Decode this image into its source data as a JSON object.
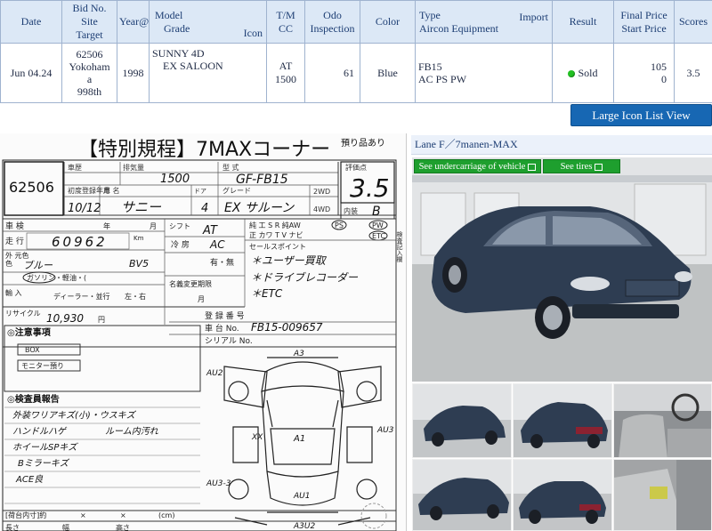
{
  "table": {
    "headers": {
      "date": "Date",
      "bid_no": "Bid No.",
      "site": "Site",
      "target": "Target",
      "year": "Year@",
      "model": "Model",
      "grade": "Grade",
      "icon": "Icon",
      "tm": "T/M",
      "cc": "CC",
      "odo": "Odo",
      "inspection": "Inspection",
      "color": "Color",
      "type": "Type",
      "import": "Import",
      "aircon_equipment": "Aircon Equipment",
      "result": "Result",
      "final_price": "Final Price",
      "start_price": "Start Price",
      "scores": "Scores"
    },
    "row": {
      "date": "Jun 04.24",
      "bid_no": "62506",
      "site_line1": "Yokoham",
      "site_line2": "a",
      "target": "998th",
      "year": "1998",
      "model_line1": "SUNNY 4D",
      "model_line2": "EX SALOON",
      "tm": "AT",
      "cc": "1500",
      "odo": "61",
      "color": "Blue",
      "type": "FB15",
      "equipment": "AC PS PW",
      "result": "Sold",
      "price_line1": "105",
      "price_line2": "0",
      "score": "3.5"
    }
  },
  "buttons": {
    "large_icon_list": "Large Icon List View",
    "undercarriage": "See undercarriage of vehicle",
    "tires": "See tires"
  },
  "lane": "Lane F／7manen-MAX",
  "sheet": {
    "title": "【特別規程】7MAXコーナー",
    "deposit": "預り品あり",
    "lot": "62506",
    "score_label": "評価点",
    "score": "3.5",
    "interior_label": "内装",
    "interior_score": "B",
    "displacement": "1500",
    "model_code": "GF-FB15",
    "year": "10/12",
    "car_name": "サニー",
    "doors": "4",
    "grade": "EX サルーン",
    "mileage": "60962",
    "color": "ブルー",
    "color_code": "BV5",
    "shift": "AT",
    "aircon": "AC",
    "price": "10,930",
    "chassis": "FB15-009657",
    "sales_points": [
      "＊ユーザー買取",
      "＊ドライブレコーダー",
      "＊ETC"
    ],
    "notes_label": "◎注意事項",
    "box_label": "BOX",
    "monitor_label": "モニター預り",
    "inspector_label": "◎検査員報告",
    "inspector_notes": [
      "外装ワリアキズ(小)・ウスキズ",
      "ハンドルハゲ",
      "ルーム内汚れ",
      "ホイールSPキズ",
      "Bミラーキズ",
      "ACE良"
    ],
    "diagram_marks": [
      "A3",
      "AU2",
      "XX",
      "A1",
      "AU3",
      "AU1",
      "AU3-3",
      "A3U2"
    ]
  },
  "colors": {
    "header_bg": "#dce8f6",
    "header_text": "#1c3d73",
    "button_blue": "#1767b3",
    "button_green": "#1e9f2e",
    "sold_dot": "#22c022",
    "car_body": "#2e3d52"
  }
}
